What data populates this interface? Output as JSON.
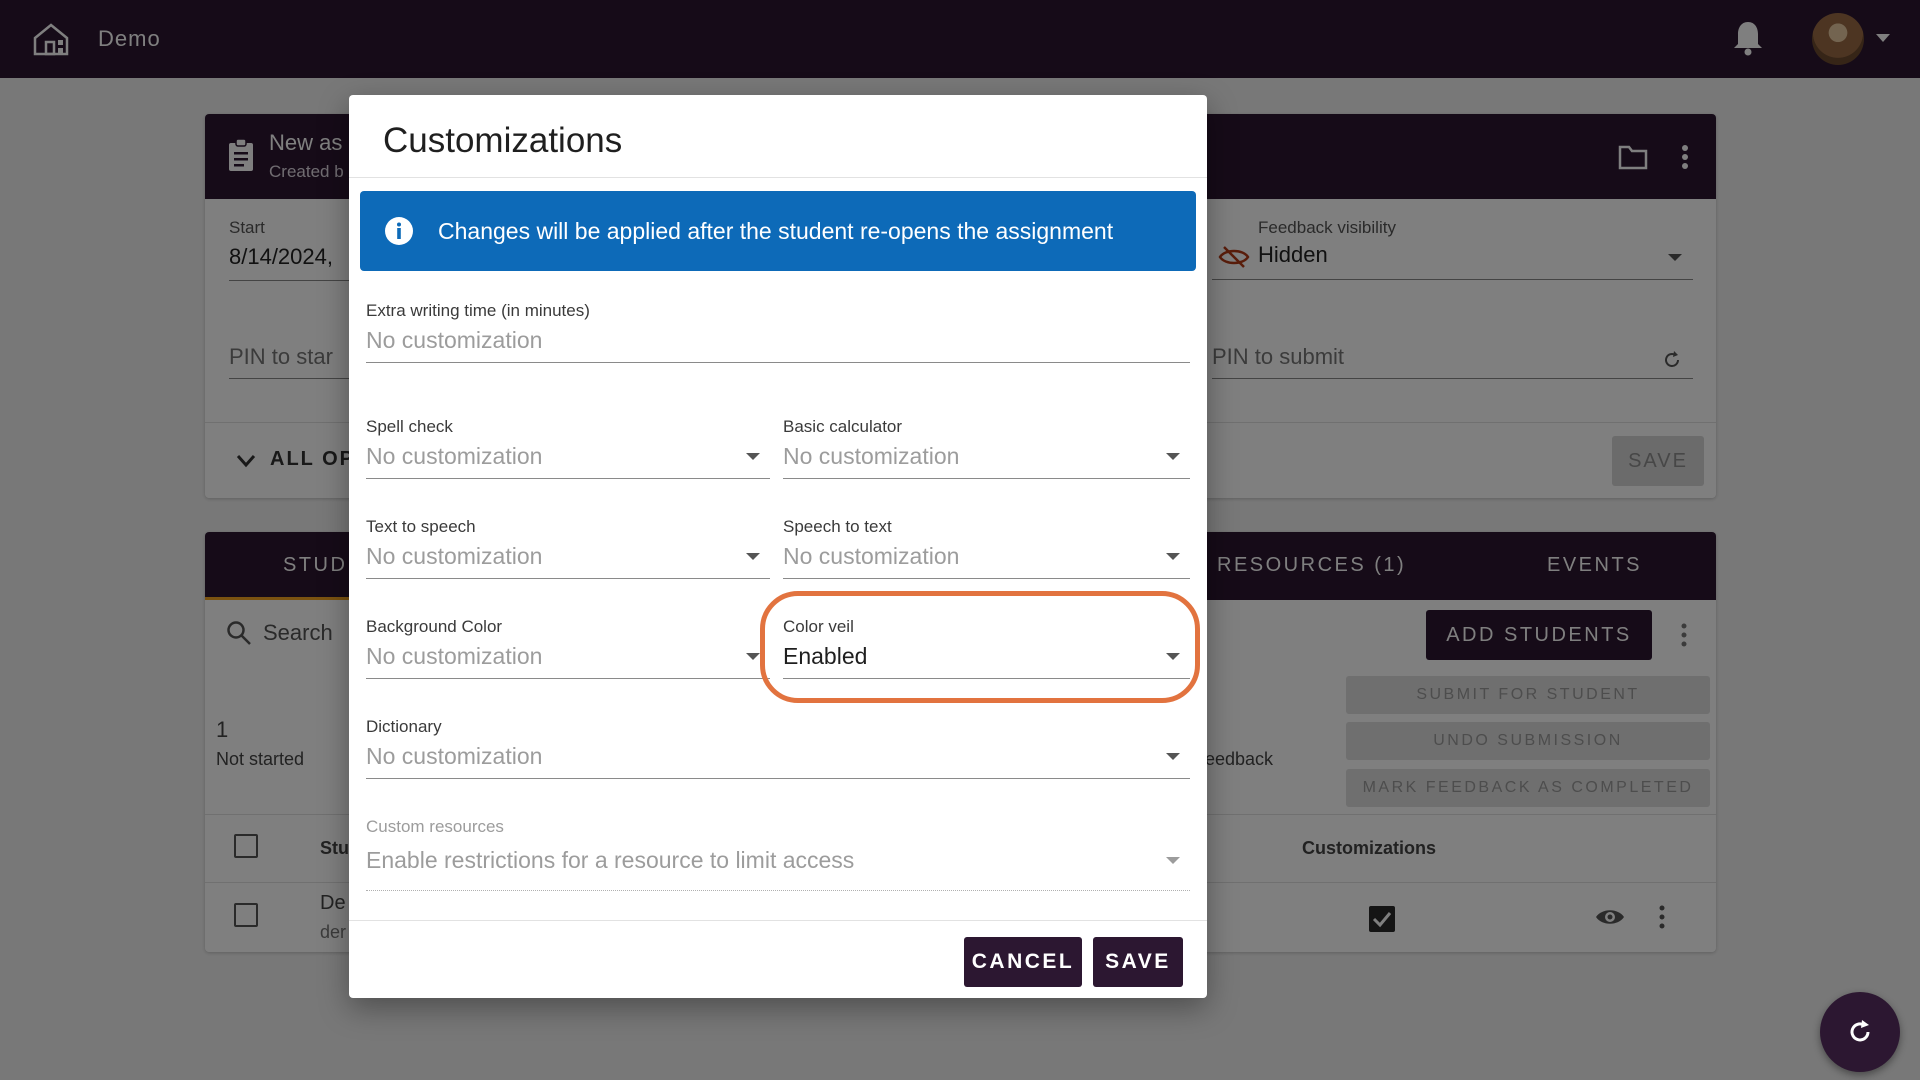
{
  "appbar": {
    "title": "Demo"
  },
  "assignment": {
    "title_partial": "New as",
    "subtitle_partial": "Created b",
    "start_label": "Start",
    "start_value": "8/14/2024,",
    "pin_start_label": "PIN to star",
    "feedback_label": "Feedback visibility",
    "feedback_value": "Hidden",
    "pin_submit_label": "PIN to submit",
    "all_options": "ALL OP",
    "save_label": "SAVE"
  },
  "tabs": {
    "students": "STUD",
    "resources": "RESOURCES (1)",
    "events": "EVENTS"
  },
  "students_panel": {
    "search_placeholder": "Search",
    "add_students": "ADD STUDENTS",
    "submit_for_student": "SUBMIT FOR STUDENT",
    "undo_submission": "UNDO SUBMISSION",
    "mark_feedback": "MARK FEEDBACK AS COMPLETED",
    "count": "1",
    "count_label": "Not started",
    "feedback_partial": "eedback",
    "col_student_partial": "Stu",
    "col_customizations": "Customizations",
    "row_name_partial": "De",
    "row_sub_partial": "der"
  },
  "dialog": {
    "title": "Customizations",
    "info_message": "Changes will be applied after the student re-opens the assignment",
    "fields": {
      "extra_time": {
        "label": "Extra writing time (in minutes)",
        "value": "No customization"
      },
      "spell_check": {
        "label": "Spell check",
        "value": "No customization"
      },
      "basic_calculator": {
        "label": "Basic calculator",
        "value": "No customization"
      },
      "text_to_speech": {
        "label": "Text to speech",
        "value": "No customization"
      },
      "speech_to_text": {
        "label": "Speech to text",
        "value": "No customization"
      },
      "background_color": {
        "label": "Background Color",
        "value": "No customization"
      },
      "color_veil": {
        "label": "Color veil",
        "value": "Enabled"
      },
      "dictionary": {
        "label": "Dictionary",
        "value": "No customization"
      },
      "custom_resources": {
        "label": "Custom resources",
        "value": "Enable restrictions for a resource to limit access"
      }
    },
    "cancel_label": "CANCEL",
    "save_label": "SAVE"
  },
  "colors": {
    "brand": "#2c1731",
    "info": "#0d6ab8",
    "highlight": "#e2733f"
  }
}
